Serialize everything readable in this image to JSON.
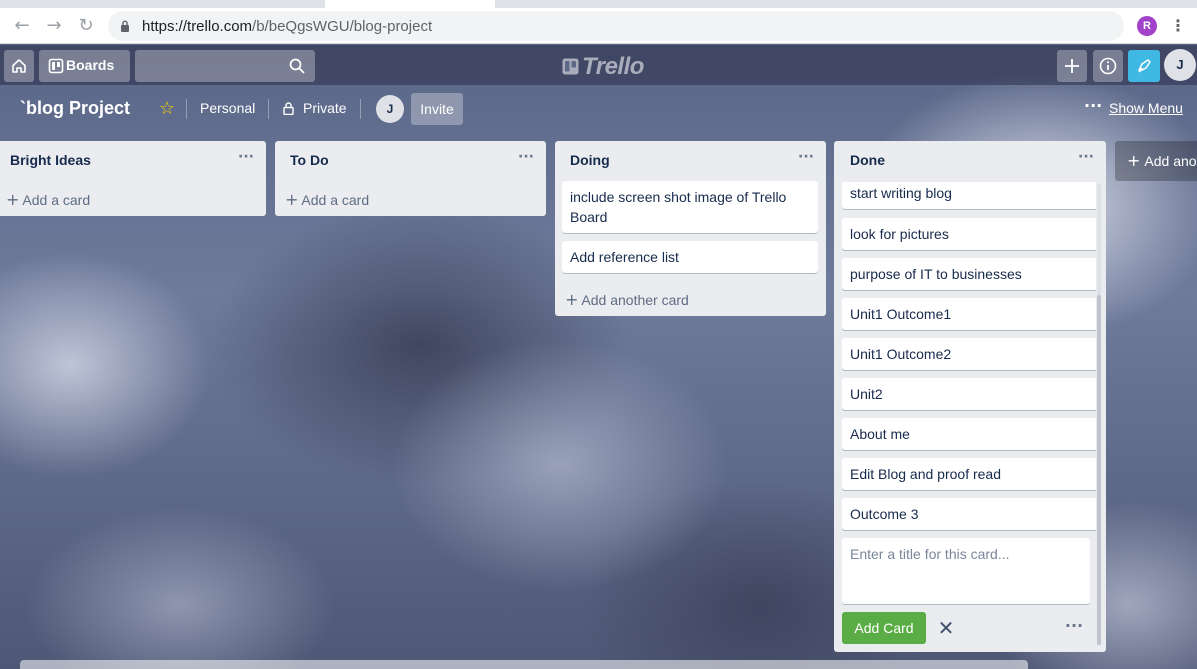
{
  "browser": {
    "url_host": "https://trello.com",
    "url_path": "/b/beQgsWGU/blog-project",
    "profile_initial": "R",
    "back_icon": "arrow-left-icon",
    "forward_icon": "arrow-right-icon",
    "reload_icon": "reload-icon"
  },
  "header": {
    "boards_label": "Boards",
    "logo_text": "Trello",
    "user_initial": "J"
  },
  "board": {
    "title": "`blog Project",
    "visibility_team": "Personal",
    "visibility_privacy": "Private",
    "member_initial": "J",
    "invite_label": "Invite",
    "show_menu_label": "Show Menu",
    "more_dots": "···"
  },
  "lists": [
    {
      "title": "Bright Ideas",
      "add_label": "Add a card",
      "cards": []
    },
    {
      "title": "To Do",
      "add_label": "Add a card",
      "cards": []
    },
    {
      "title": "Doing",
      "add_label": "Add another card",
      "cards": [
        "include screen shot image of Trello Board",
        "Add reference list"
      ]
    },
    {
      "title": "Done",
      "cards": [
        "start writing blog",
        "look for pictures",
        "purpose of IT to businesses",
        "Unit1 Outcome1",
        "Unit1 Outcome2",
        "Unit2",
        "About me",
        "Edit Blog and proof read",
        "Outcome 3"
      ],
      "composer_placeholder": "Enter a title for this card...",
      "add_button_label": "Add Card"
    }
  ],
  "add_another_list_label": "Add another list",
  "colors": {
    "add_card_green": "#5aac44",
    "list_bg": "#ebecf0",
    "star_yellow": "#f2d600"
  }
}
